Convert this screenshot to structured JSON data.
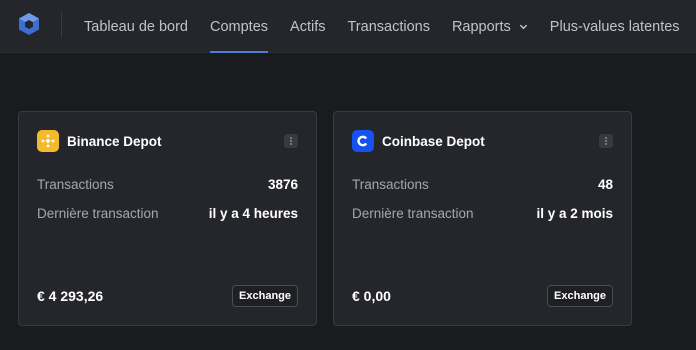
{
  "nav": {
    "items": [
      {
        "label": "Tableau de bord"
      },
      {
        "label": "Comptes"
      },
      {
        "label": "Actifs"
      },
      {
        "label": "Transactions"
      },
      {
        "label": "Rapports"
      },
      {
        "label": "Plus-values latentes"
      }
    ],
    "active": "Comptes"
  },
  "cards": [
    {
      "title": "Binance Depot",
      "icon": "binance-icon",
      "color": "#f3ba2f",
      "transactions_label": "Transactions",
      "transactions_value": "3876",
      "last_label": "Dernière transaction",
      "last_value": "il y a 4 heures",
      "amount": "€ 4 293,26",
      "badge": "Exchange"
    },
    {
      "title": "Coinbase Depot",
      "icon": "coinbase-icon",
      "color": "#1652f0",
      "transactions_label": "Transactions",
      "transactions_value": "48",
      "last_label": "Dernière transaction",
      "last_value": "il y a 2 mois",
      "amount": "€ 0,00",
      "badge": "Exchange"
    }
  ],
  "colors": {
    "accent": "#4d7bd6",
    "background": "#1a1b1e",
    "card": "#25262b"
  }
}
